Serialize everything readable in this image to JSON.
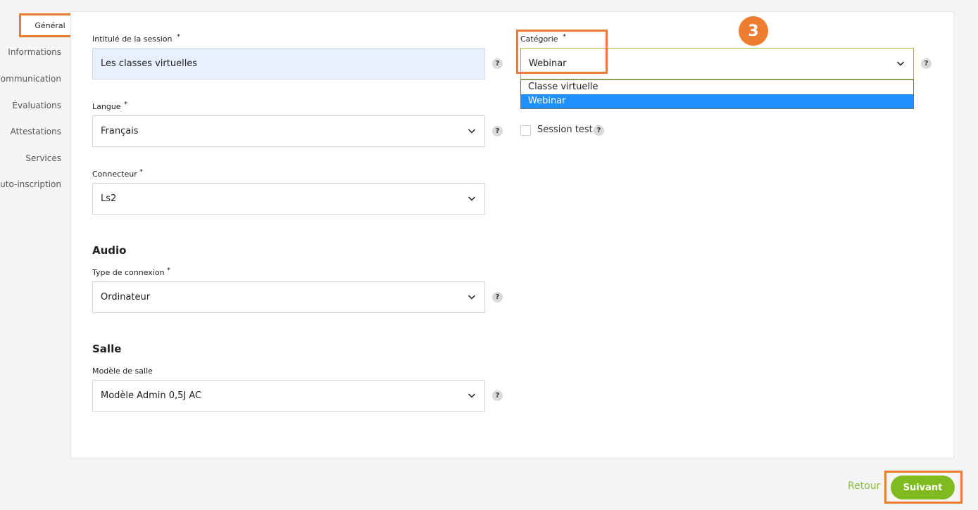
{
  "sidebar": {
    "active": "Général",
    "items": [
      "Informations",
      "Communication",
      "Évaluations",
      "Attestations",
      "Services",
      "Auto-inscription"
    ]
  },
  "form": {
    "session_title": {
      "label": "Intitulé de la session",
      "required_mark": "*",
      "value": "Les classes virtuelles"
    },
    "language": {
      "label": "Langue",
      "required_mark": "*",
      "value": "Français"
    },
    "connector": {
      "label": "Connecteur",
      "required_mark": "*",
      "value": "Ls2"
    },
    "audio": {
      "section_title": "Audio",
      "connection_type": {
        "label": "Type de connexion",
        "required_mark": "*",
        "value": "Ordinateur"
      }
    },
    "room": {
      "section_title": "Salle",
      "room_model": {
        "label": "Modèle de salle",
        "value": "Modèle Admin 0,5J AC"
      }
    },
    "category": {
      "label": "Catégorie",
      "required_mark": "*",
      "value": "Webinar",
      "options": [
        "Classe virtuelle",
        "Webinar"
      ],
      "selected_option": "Webinar"
    },
    "session_test": {
      "label": "Session test",
      "checked": false
    }
  },
  "help_glyph": "?",
  "step_badge": "3",
  "footer": {
    "back_label": "Retour",
    "next_label": "Suivant"
  },
  "colors": {
    "accent_orange": "#ed7d31",
    "brand_green": "#7fba1f",
    "selected_blue": "#1e90ff"
  }
}
